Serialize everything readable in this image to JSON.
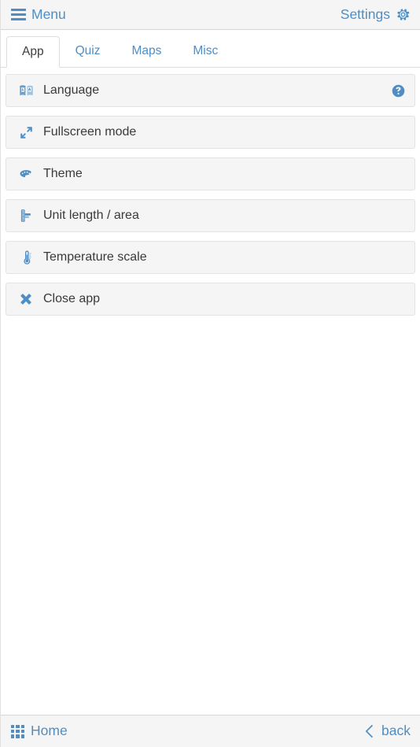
{
  "header": {
    "menu_label": "Menu",
    "menu_icon": "hamburger-icon",
    "settings_label": "Settings",
    "settings_icon": "gear-icon"
  },
  "tabs": [
    {
      "label": "App",
      "active": true
    },
    {
      "label": "Quiz",
      "active": false
    },
    {
      "label": "Maps",
      "active": false
    },
    {
      "label": "Misc",
      "active": false
    }
  ],
  "settings_rows": [
    {
      "label": "Language",
      "icon": "language-icon",
      "help": true
    },
    {
      "label": "Fullscreen mode",
      "icon": "expand-icon",
      "help": false
    },
    {
      "label": "Theme",
      "icon": "palette-icon",
      "help": false
    },
    {
      "label": "Unit length / area",
      "icon": "ruler-icon",
      "help": false
    },
    {
      "label": "Temperature scale",
      "icon": "thermometer-icon",
      "help": false
    },
    {
      "label": "Close app",
      "icon": "close-x-icon",
      "help": false
    }
  ],
  "footer": {
    "home_label": "Home",
    "home_icon": "grid-icon",
    "back_label": "back",
    "back_icon": "chevron-left-icon"
  },
  "colors": {
    "accent": "#4f8ec4",
    "row_bg": "#f5f5f5",
    "row_border": "#e3e3e3",
    "bar_bg": "#f5f5f5",
    "text": "#3a3a3a",
    "active_tab_text": "#3d3d3d"
  }
}
